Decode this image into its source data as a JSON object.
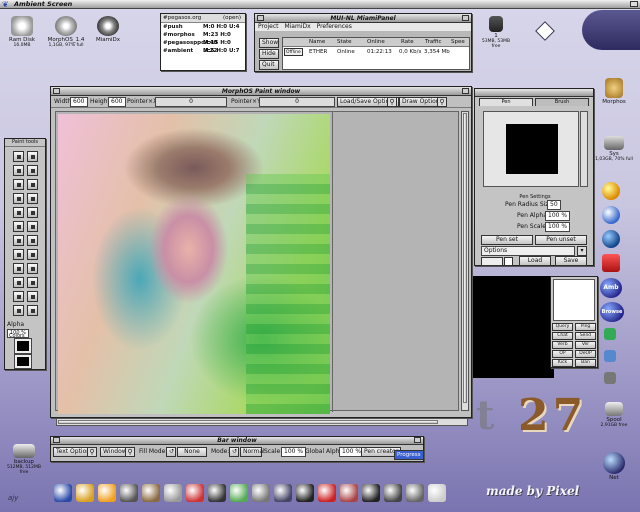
{
  "screen": {
    "title": "Ambient Screen",
    "clock_corner": "27"
  },
  "desktop_icons": [
    {
      "label": "Ram Disk",
      "sub": "16.0MB"
    },
    {
      "label": "MorphOS_1.4",
      "sub": "1,1GB, 97% full"
    },
    {
      "label": "MiamiDx",
      "sub": ""
    }
  ],
  "disk_widget": {
    "number": "1",
    "sub": "53MB, 53MB free"
  },
  "irc": {
    "channel_header": "#pegasos.org",
    "open_label": "(open)",
    "rows": [
      {
        "name": "#push",
        "mode": "M:0 H:0 U:4"
      },
      {
        "name": "#morphos",
        "mode": "M:23 H:0 U:40"
      },
      {
        "name": "#pegasosppc",
        "mode": "M:15 H:0 U:22"
      },
      {
        "name": "#ambient",
        "mode": "M:5 H:0 U:7"
      }
    ]
  },
  "mui_panel": {
    "title": "MUI-NL MiamiPanel",
    "menu": [
      "Project",
      "MiamiDx",
      "Preferences"
    ],
    "buttons": [
      "Show",
      "Hide",
      "Quit"
    ],
    "headers": [
      "Name",
      "State",
      "Online",
      "Rate",
      "Traffic",
      "Spee"
    ],
    "row": {
      "toggle": "Offline",
      "name": "ETHER",
      "state": "Online",
      "online": "01:22:13",
      "rate": "0,0 Kb/s",
      "traffic": "3,354 Mb",
      "speed": ""
    }
  },
  "paint": {
    "title": "MorphOS Paint window",
    "width_label": "Width",
    "width_value": "600",
    "height_label": "Height",
    "height_value": "600",
    "px_label": "Pointer×X",
    "px_value": "0",
    "py_label": "Pointer×Y",
    "py_value": "0",
    "load_save": "Load/Save Options",
    "draw_options": "Draw Options"
  },
  "paint_tools": {
    "title": "Paint tools",
    "alpha_label": "Alpha",
    "alpha_value": "100 %",
    "colors_label": "Colors"
  },
  "pen": {
    "tabs": [
      "Pen",
      "Brush"
    ],
    "settings_title": "Pen Settings",
    "radius_label": "Pen Radius Size",
    "radius_value": "50",
    "alpha_label": "Pen Alpha",
    "alpha_value": "100 %",
    "scale_label": "Pen Scale",
    "scale_value": "100 %",
    "set_label": "Pen set",
    "unset_label": "Pen unset",
    "options_label": "Options",
    "load_label": "Load",
    "save_label": "Save"
  },
  "bar": {
    "title": "Bar window",
    "text_options": "Text Options",
    "windows": "Windows",
    "fill_label": "Fill Mode:",
    "fill_value": "None",
    "mode_label": "Mode:",
    "mode_value": "Normal",
    "scale_label": "Scale",
    "scale_value": "100 %",
    "galpha_label": "Global Alpha",
    "galpha_value": "100 %",
    "pen_creator": "Pen creator",
    "progress": "Progress"
  },
  "mini_buttons": [
    "Query",
    "Ping",
    "Chat",
    "Send",
    "Verb",
    "Ver",
    "OP",
    "DeOP",
    "Kick",
    "Ban"
  ],
  "right_icons": [
    {
      "label": "Morphos",
      "sub": ""
    },
    {
      "label": "Sys",
      "sub": "1,03GB, 70% full"
    },
    {
      "label": "Spool",
      "sub": "2,91GB free"
    },
    {
      "label": "Net",
      "sub": ""
    },
    {
      "label": "Ambient",
      "sub": ""
    }
  ],
  "right_buttons": [
    "Amb",
    "Browse"
  ],
  "backup": {
    "label": "backup",
    "sub": "512MB, 512MB free"
  },
  "banner": "made by Pixel",
  "signature": "ajy",
  "colors": {
    "title_bar": "#bdbdbd",
    "progress": "#3a5fd0",
    "desktop_top": "#d8d6ea",
    "desktop_bottom": "#7a74b0"
  }
}
